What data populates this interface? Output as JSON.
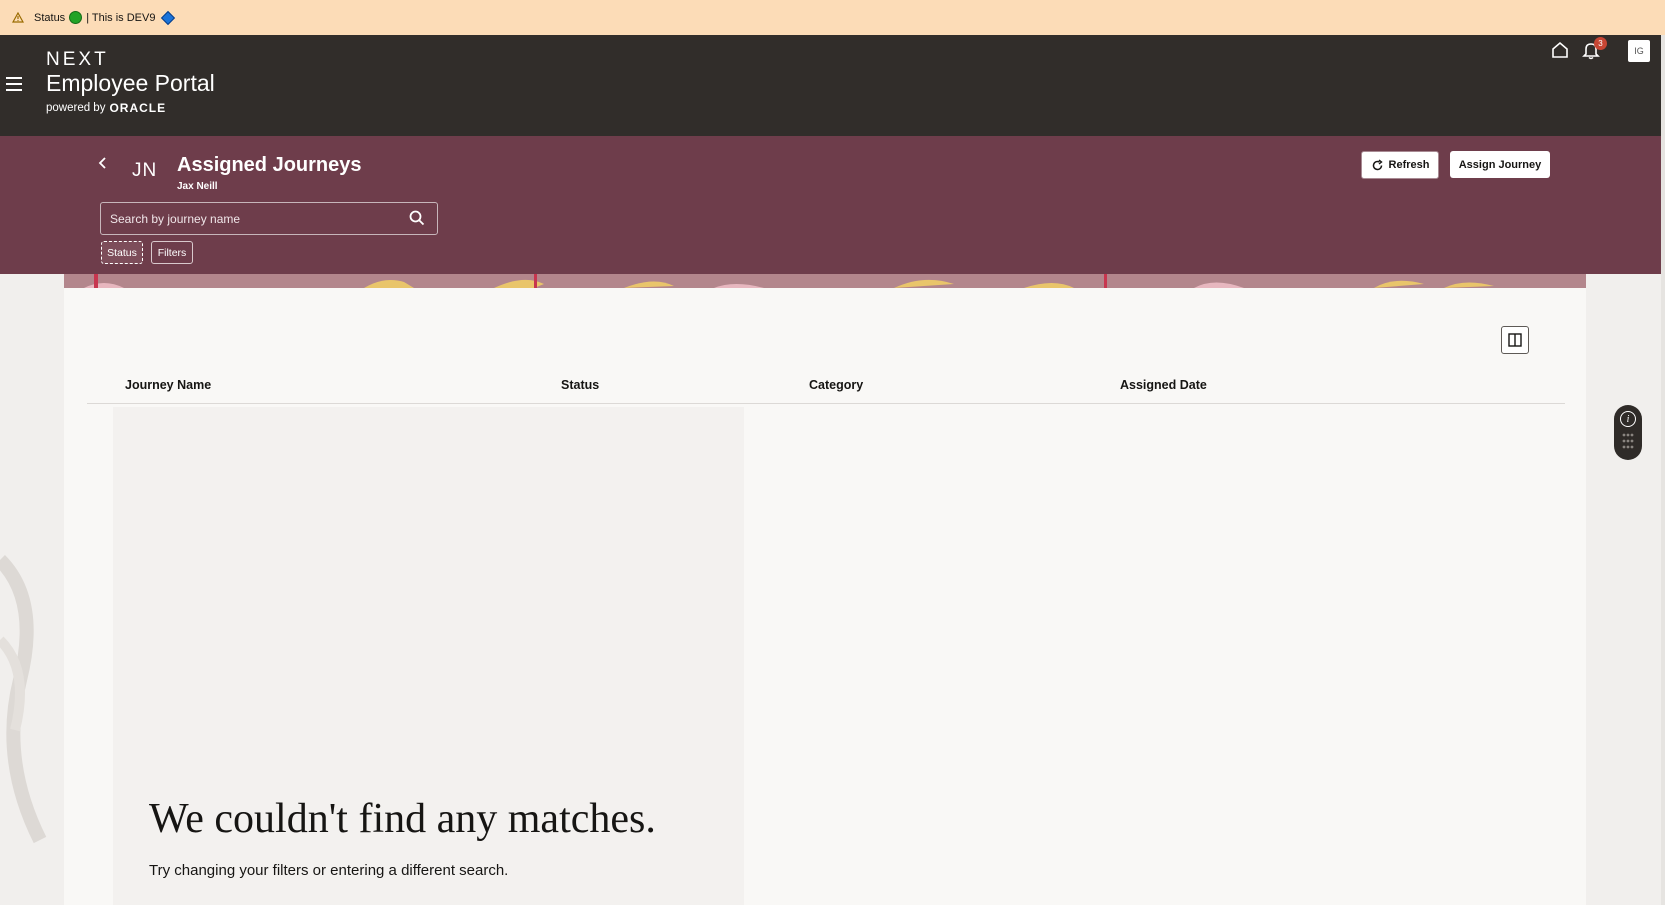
{
  "dev_banner": {
    "status_label": "Status",
    "env_text": "| This is DEV9"
  },
  "header": {
    "brand_next": "NEXT",
    "brand_title": "Employee Portal",
    "powered_by": "powered by",
    "oracle": "ORACLE",
    "notification_count": "3",
    "avatar_initials": "IG"
  },
  "page": {
    "initials": "JN",
    "title": "Assigned Journeys",
    "subtitle": "Jax Neill",
    "refresh_label": "Refresh",
    "assign_label": "Assign Journey",
    "search_placeholder": "Search by journey name",
    "chips": {
      "status": "Status",
      "filters": "Filters"
    }
  },
  "table": {
    "columns": [
      "Journey Name",
      "Status",
      "Category",
      "Assigned Date"
    ]
  },
  "empty_state": {
    "title": "We couldn't find any matches.",
    "message": "Try changing your filters or entering a different search."
  },
  "colors": {
    "banner": "#fcdcb7",
    "header": "#312d2a",
    "band": "#6e3d4b",
    "badge": "#c74634"
  }
}
